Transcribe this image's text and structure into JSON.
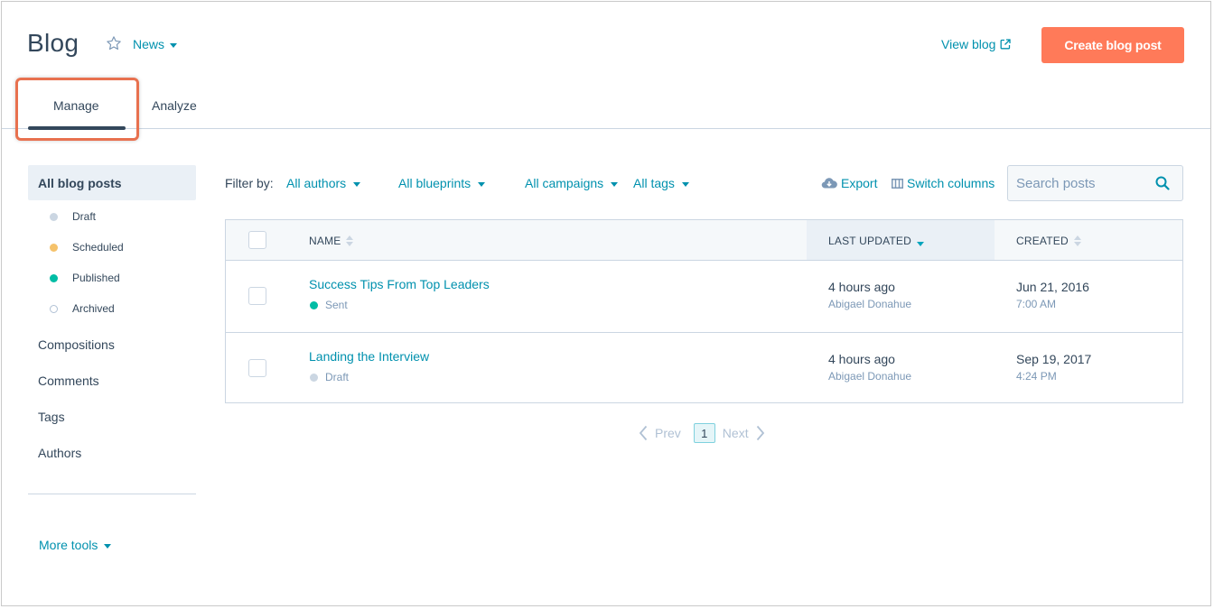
{
  "header": {
    "title": "Blog",
    "blog_selector": "News",
    "view_blog": "View blog",
    "create_button": "Create blog post"
  },
  "tabs": [
    {
      "label": "Manage",
      "active": true
    },
    {
      "label": "Analyze",
      "active": false
    }
  ],
  "sidebar": {
    "active_item": "All blog posts",
    "status_items": [
      {
        "label": "Draft",
        "color": "#cbd6e2"
      },
      {
        "label": "Scheduled",
        "color": "#f5c26b"
      },
      {
        "label": "Published",
        "color": "#00bda5"
      },
      {
        "label": "Archived",
        "color": "outline"
      }
    ],
    "items": [
      "Compositions",
      "Comments",
      "Tags",
      "Authors"
    ],
    "more_tools": "More tools"
  },
  "filters": {
    "label": "Filter by:",
    "authors": "All authors",
    "blueprints": "All blueprints",
    "campaigns": "All campaigns",
    "tags": "All tags",
    "export": "Export",
    "switch_columns": "Switch columns",
    "search_placeholder": "Search posts"
  },
  "table": {
    "headers": [
      "NAME",
      "LAST UPDATED",
      "CREATED"
    ],
    "rows": [
      {
        "title": "Success Tips From Top Leaders",
        "status": "Sent",
        "status_color": "#00bda5",
        "updated": "4 hours ago",
        "updated_by": "Abigael Donahue",
        "created_date": "Jun 21, 2016",
        "created_time": "7:00 AM"
      },
      {
        "title": "Landing the Interview",
        "status": "Draft",
        "status_color": "#cbd6e2",
        "updated": "4 hours ago",
        "updated_by": "Abigael Donahue",
        "created_date": "Sep 19, 2017",
        "created_time": "4:24 PM"
      }
    ]
  },
  "pagination": {
    "prev": "Prev",
    "current": "1",
    "next": "Next"
  },
  "colors": {
    "accent": "#ff7a59",
    "link": "#0091ae",
    "text": "#33475b",
    "highlight": "#e8714f"
  }
}
